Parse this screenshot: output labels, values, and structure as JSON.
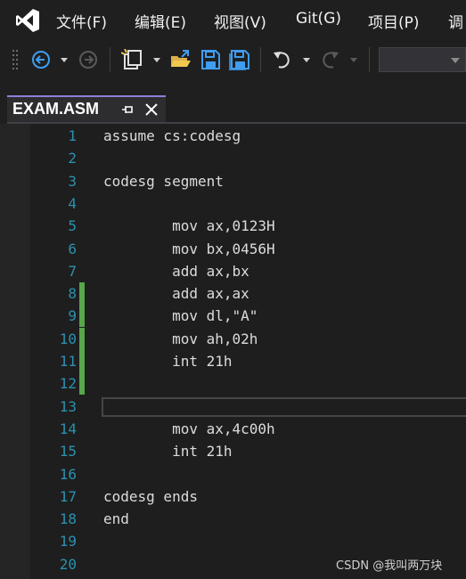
{
  "menu": {
    "items": [
      {
        "label": "文件(F)"
      },
      {
        "label": "编辑(E)"
      },
      {
        "label": "视图(V)"
      },
      {
        "label": "Git(G)"
      },
      {
        "label": "项目(P)"
      },
      {
        "label": "调"
      }
    ]
  },
  "toolbar": {
    "icons": [
      "back-icon",
      "dropdown-icon",
      "forward-icon",
      "new-project-icon",
      "open-icon",
      "save-icon",
      "save-all-icon",
      "undo-icon",
      "redo-icon"
    ],
    "config_value": ""
  },
  "tab": {
    "title": "EXAM.ASM"
  },
  "editor": {
    "lines": [
      {
        "num": "1",
        "text": "assume cs:codesg",
        "changed": false
      },
      {
        "num": "2",
        "text": "",
        "changed": false
      },
      {
        "num": "3",
        "text": "codesg segment",
        "changed": false
      },
      {
        "num": "4",
        "text": "",
        "changed": false
      },
      {
        "num": "5",
        "text": "        mov ax,0123H",
        "changed": false
      },
      {
        "num": "6",
        "text": "        mov bx,0456H",
        "changed": false
      },
      {
        "num": "7",
        "text": "        add ax,bx",
        "changed": false
      },
      {
        "num": "8",
        "text": "        add ax,ax",
        "changed": true
      },
      {
        "num": "9",
        "text": "        mov dl,\"A\"",
        "changed": true
      },
      {
        "num": "10",
        "text": "        mov ah,02h",
        "changed": true
      },
      {
        "num": "11",
        "text": "        int 21h",
        "changed": true
      },
      {
        "num": "12",
        "text": "",
        "changed": true
      },
      {
        "num": "13",
        "text": "",
        "changed": false
      },
      {
        "num": "14",
        "text": "        mov ax,4c00h",
        "changed": false
      },
      {
        "num": "15",
        "text": "        int 21h",
        "changed": false
      },
      {
        "num": "16",
        "text": "",
        "changed": false
      },
      {
        "num": "17",
        "text": "codesg ends",
        "changed": false
      },
      {
        "num": "18",
        "text": "end",
        "changed": false
      },
      {
        "num": "19",
        "text": "",
        "changed": false
      },
      {
        "num": "20",
        "text": "",
        "changed": false
      }
    ],
    "current_line": "13"
  },
  "colors": {
    "line_number": "#2b91af",
    "change_bar": "#57a64a",
    "tab_accent": "#8b7fd8"
  },
  "watermark": "CSDN @我叫两万块"
}
